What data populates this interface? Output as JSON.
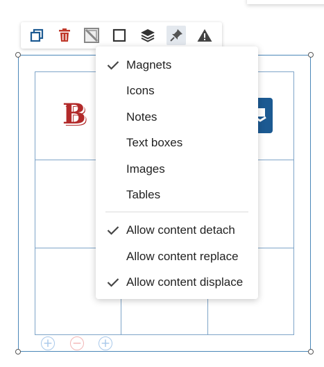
{
  "toolbar": {
    "buttons": [
      {
        "icon": "duplicate-icon",
        "color": "#1c5a92"
      },
      {
        "icon": "trash-icon",
        "color": "#c0392b"
      },
      {
        "icon": "crop-disabled-icon",
        "color": "#888888"
      },
      {
        "icon": "square-icon",
        "color": "#333333"
      },
      {
        "icon": "layers-icon",
        "color": "#333333"
      },
      {
        "icon": "pin-icon",
        "color": "#555555",
        "active": true
      },
      {
        "icon": "warning-icon",
        "color": "#444444"
      }
    ]
  },
  "menu": {
    "items": [
      {
        "label": "Magnets",
        "checked": true
      },
      {
        "label": "Icons",
        "checked": false
      },
      {
        "label": "Notes",
        "checked": false
      },
      {
        "label": "Text boxes",
        "checked": false
      },
      {
        "label": "Images",
        "checked": false
      },
      {
        "label": "Tables",
        "checked": false
      }
    ],
    "options": [
      {
        "label": "Allow content detach",
        "checked": true
      },
      {
        "label": "Allow content replace",
        "checked": false
      },
      {
        "label": "Allow content displace",
        "checked": true
      }
    ]
  },
  "canvas": {
    "logo_letter": "B",
    "logo_color": "#b22a2a",
    "tile_color": "#1c5a92"
  },
  "table_controls": [
    {
      "symbol": "+",
      "type": "add-column"
    },
    {
      "symbol": "−",
      "type": "remove-column"
    },
    {
      "symbol": "+",
      "type": "add-row"
    }
  ]
}
